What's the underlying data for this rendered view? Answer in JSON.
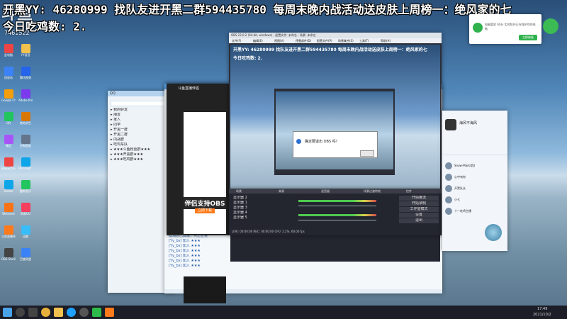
{
  "overlay": {
    "line1": "开黑YY: 46280999  找队友进开黑二群594435780   每周末晚内战活动送皮肤上周榜一：绝风家的七",
    "line2": "今日吃鸡数: 2.",
    "logo": "斗鱼",
    "room_id": "7461522"
  },
  "obs": {
    "title": "OBS 23.0.2 (64-bit, windows) - 配置文件: 未命名 - 场景: 未命名",
    "menus": [
      "文件(F)",
      "编辑(E)",
      "视图(V)",
      "停靠部件(D)",
      "配置文件(P)",
      "场景集合(S)",
      "工具(T)",
      "帮助(H)"
    ],
    "preview_text": "开黑YY: 46280999  找队友进开黑二群594435780   每周末晚内战活动送皮肤上周榜一：绝风家的七",
    "preview_text2": "今日吃鸡数: 2.",
    "dialog_text": "确定要退出 OBS 吗？",
    "docks": [
      "场景",
      "来源",
      "混音器",
      "场景过渡特效",
      "控件"
    ],
    "controls": [
      "开始推流",
      "开始录制",
      "工作室模式",
      "设置",
      "退出"
    ],
    "sources": [
      "显示器 2",
      "显示器 1",
      "显示器 3",
      "显示器 4",
      "显示器 5"
    ],
    "status": "LIVE: 00:00:00   REC: 00:00:00   CPU: 2.2%, 60.00 fps"
  },
  "qq": {
    "title": "QQ",
    "groups": [
      "我的好友",
      "朋友",
      "家人",
      "同学",
      "开黑一群",
      "开黑二群",
      "内战群",
      "吃鸡车队",
      "★★★斗鱼粉丝群★★★",
      "★★★开黑群★★★",
      "★★★吃鸡群★★★"
    ],
    "chat_lines": [
      "群消息已屏蔽，点击查看",
      "[Yy_bs] 加入 ★★★",
      "[Yy_bs] 加入 ★★★",
      "[Yy_bs] 加入 ★★★",
      "[Yy_bs] 加入 ★★★",
      "[Yy_bs] 加入 ★★★",
      "[Yy_bs] 加入 ★★★"
    ],
    "bottom_label": "开黑二群"
  },
  "ad": {
    "title": "伴侣支持OBS",
    "sub": "立即下载",
    "header": "斗鱼直播伴侣"
  },
  "profile": {
    "name": "海风不海风",
    "contacts": [
      "Snow-Mark(我)",
      "心中有你",
      "开黑队长",
      "小七",
      "十一吃鸡主播"
    ],
    "stream_note": "Snow-Mark(我最爱)"
  },
  "notify": {
    "text": "电脑管家 60分 实时防护正在保护你的电脑",
    "button": "立即修复"
  },
  "taskbar": {
    "search": "",
    "time": "17:49",
    "date": "2021/10/2"
  },
  "desktop_icons": [
    "此电脑",
    "回收站",
    "Google Chrome",
    "QQ",
    "微信",
    "网易云音乐",
    "Steam",
    "WeGame",
    "斗鱼直播伴侣",
    "OBS Studio",
    "YY语音",
    "腾讯视频",
    "Adobe Premiere",
    "绝地求生",
    "控制面板",
    "Microsoft Edge",
    "酷狗音乐",
    "网易UU",
    "迅雷",
    "百度网盘"
  ]
}
